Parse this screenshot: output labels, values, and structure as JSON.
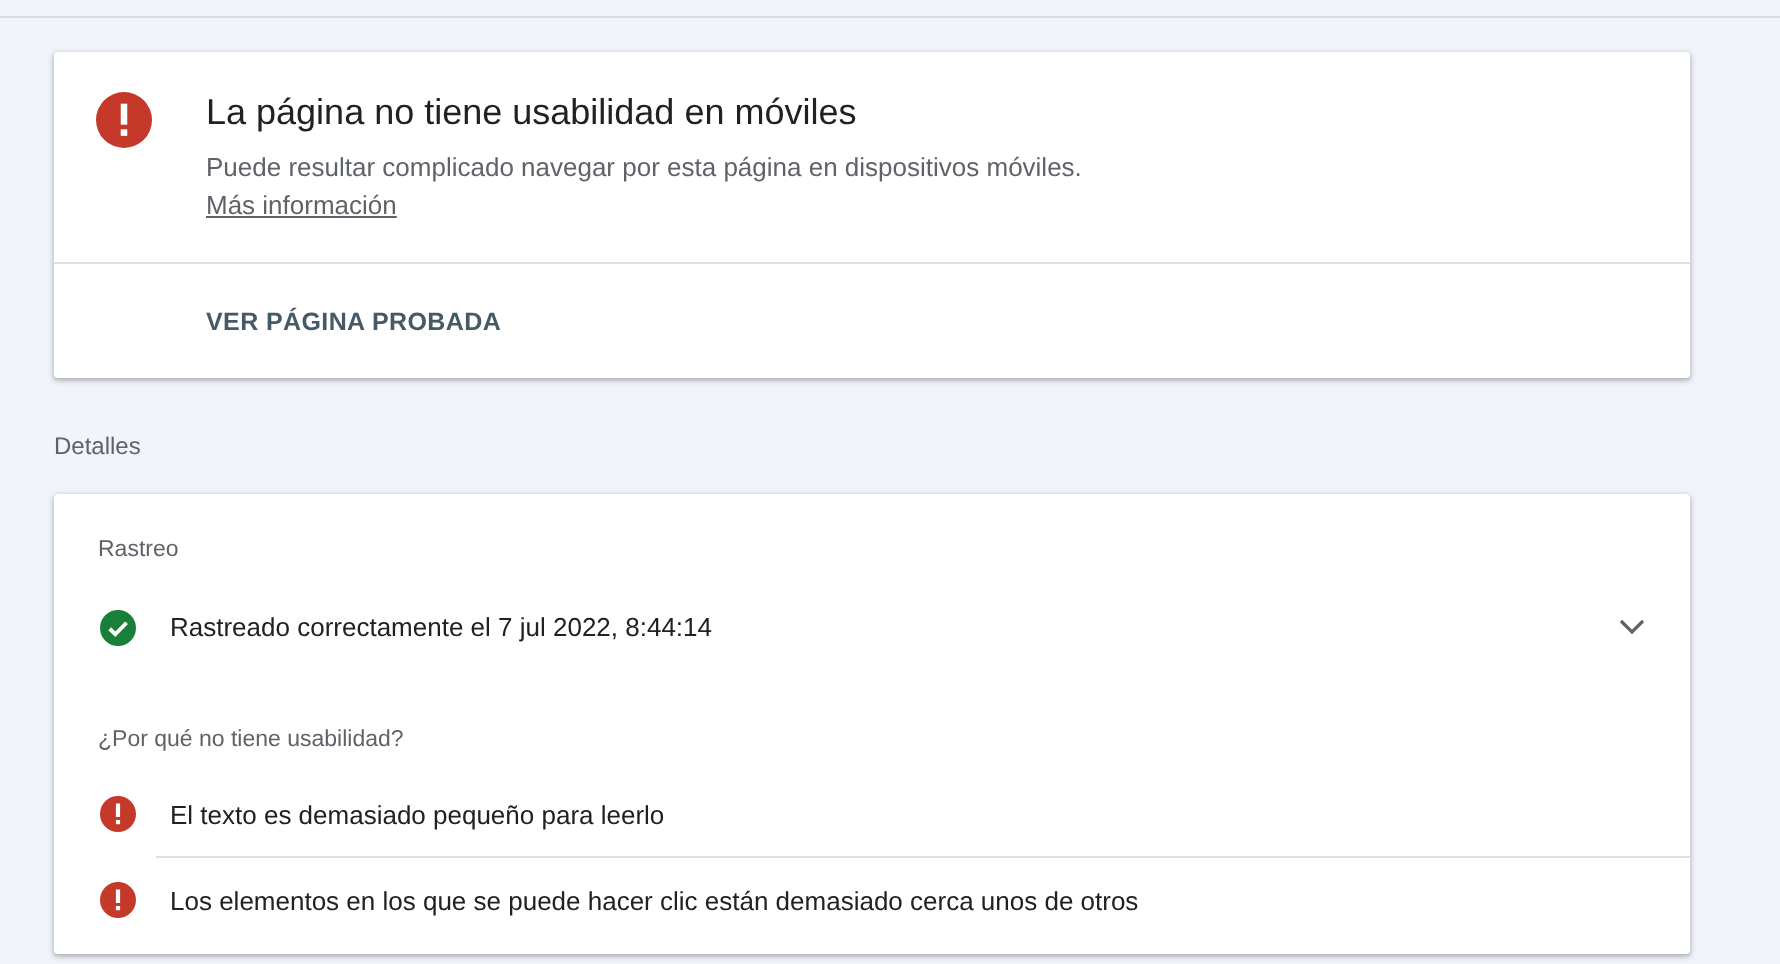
{
  "summary": {
    "kind": "error",
    "title": "La página no tiene usabilidad en móviles",
    "description": "Puede resultar complicado navegar por esta página en dispositivos móviles.",
    "link": "Más información",
    "action": "VER PÁGINA PROBADA"
  },
  "details_heading": "Detalles",
  "details": {
    "crawl_heading": "Rastreo",
    "crawl": {
      "kind": "success",
      "text": "Rastreado correctamente el 7 jul 2022, 8:44:14",
      "expanded": false
    },
    "issues_heading": "¿Por qué no tiene usabilidad?",
    "issues": [
      {
        "kind": "error",
        "text": "El texto es demasiado pequeño para leerlo"
      },
      {
        "kind": "error",
        "text": "Los elementos en los que se puede hacer clic están demasiado cerca unos de otros"
      }
    ]
  }
}
